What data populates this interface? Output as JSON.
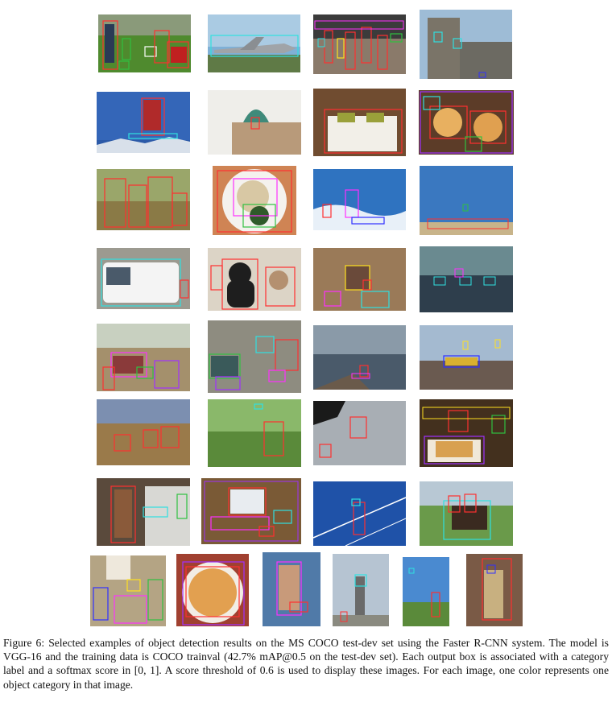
{
  "figure": {
    "caption": {
      "label": "Figure 6:",
      "text": "Selected examples of object detection results on the MS COCO test-dev set using the Faster R-CNN system. The model is VGG-16 and the training data is COCO trainval (42.7% mAP@0.5 on the test-dev set). Each output box is associated with a category label and a softmax score in [0, 1]. A score threshold of 0.6 is used to display these images. For each image, one color represents one object category in that image."
    }
  }
}
